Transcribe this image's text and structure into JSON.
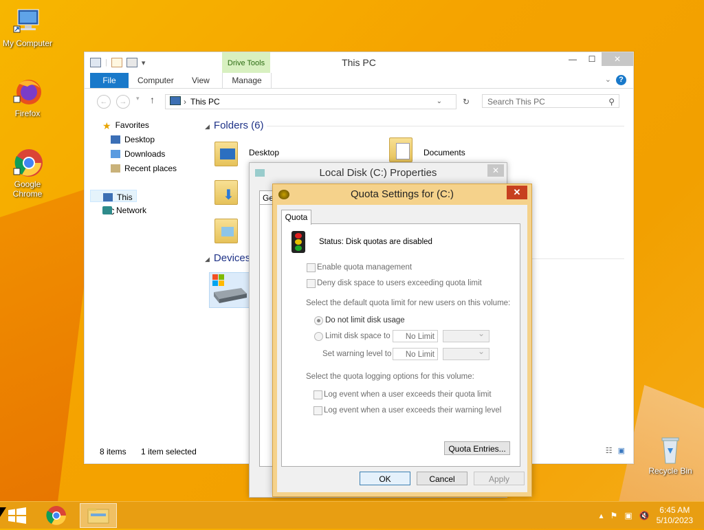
{
  "desktop": {
    "icons": [
      {
        "label": "My Computer"
      },
      {
        "label": "Firefox"
      },
      {
        "label": "Google Chrome"
      },
      {
        "label": "Recycle Bin"
      }
    ]
  },
  "explorer": {
    "title": "This PC",
    "contextual_tab_group": "Drive Tools",
    "ribbon_tabs": [
      "File",
      "Computer",
      "View",
      "Manage"
    ],
    "help": "?",
    "address": "This PC",
    "search_placeholder": "Search This PC",
    "nav": {
      "favorites": "Favorites",
      "desktop": "Desktop",
      "downloads": "Downloads",
      "recent": "Recent places",
      "this_pc": "This PC",
      "network": "Network"
    },
    "groups": {
      "folders": "Folders (6)",
      "devices": "Devices"
    },
    "folders": [
      "Desktop",
      "Documents"
    ],
    "status": {
      "items": "8 items",
      "selected": "1 item selected"
    }
  },
  "properties": {
    "title": "Local Disk (C:) Properties",
    "tab_stub": "Ge"
  },
  "quota": {
    "title": "Quota Settings for  (C:)",
    "tab": "Quota",
    "status": "Status:  Disk quotas are disabled",
    "enable_label": "Enable quota management",
    "deny_label": "Deny disk space to users exceeding quota limit",
    "default_limit_heading": "Select the default quota limit for new users on this volume:",
    "no_limit_label": "Do not limit disk usage",
    "limit_label": "Limit disk space to",
    "warning_label": "Set warning level to",
    "limit_value": "No Limit",
    "warning_value": "No Limit",
    "logging_heading": "Select the quota logging options for this volume:",
    "log_limit_label": "Log event when a user exceeds their quota limit",
    "log_warning_label": "Log event when a user exceeds their warning level",
    "entries_button": "Quota Entries...",
    "ok": "OK",
    "cancel": "Cancel",
    "apply": "Apply"
  },
  "taskbar": {
    "time": "6:45 AM",
    "date": "5/10/2023"
  },
  "colors": {
    "accent": "#1979ca",
    "drive_tools": "#d8f0c0",
    "quota_frame": "#f5d28b",
    "close_red": "#c7401f",
    "taskbar": "#e89e12"
  }
}
